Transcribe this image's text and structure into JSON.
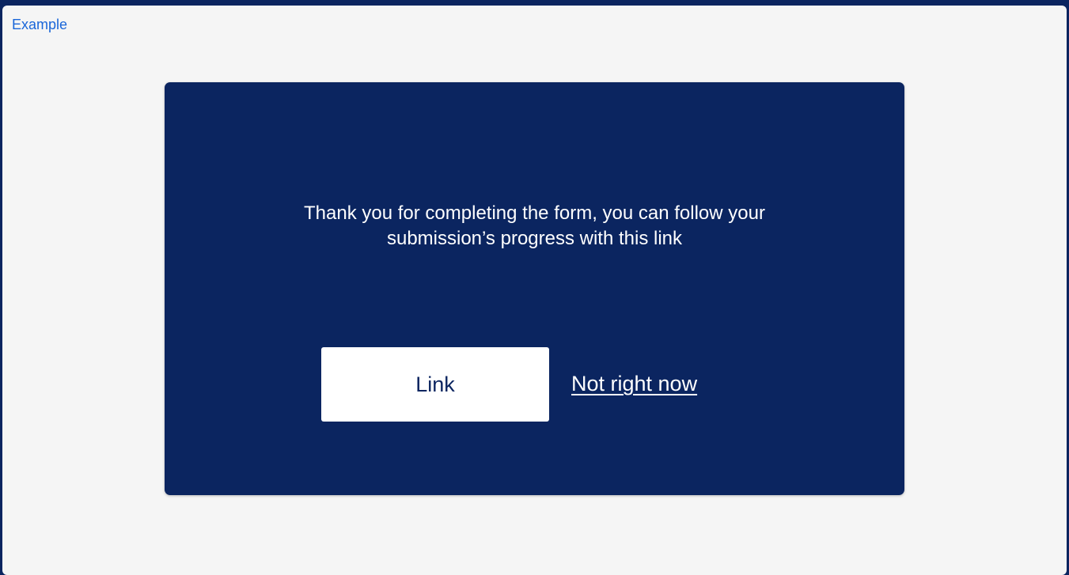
{
  "header": {
    "example_label": "Example"
  },
  "dialog": {
    "message_line1": "Thank you for completing the form, you can follow your",
    "message_line2": "submission’s progress with this link",
    "primary_button_label": "Link",
    "secondary_link_label": "Not right now"
  },
  "colors": {
    "panel_background": "#0b2560",
    "page_background": "#f5f5f5",
    "example_label": "#1a66d9",
    "text_on_panel": "#ffffff"
  }
}
